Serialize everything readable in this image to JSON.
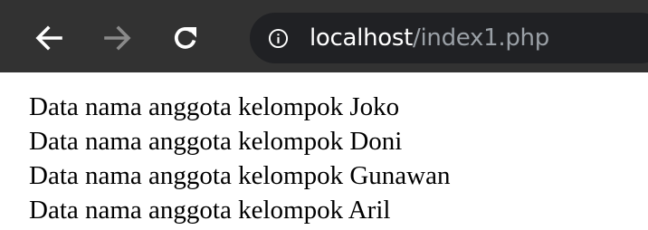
{
  "toolbar": {
    "back_icon": "arrow-left-icon",
    "forward_icon": "arrow-right-icon",
    "reload_icon": "reload-icon",
    "info_icon": "info-icon",
    "colors": {
      "toolbar_bg": "#323232",
      "omnibox_bg": "#202124",
      "icon_active": "#ffffff",
      "icon_disabled": "#8a8a8a",
      "url_path": "#9aa0a6"
    }
  },
  "address_bar": {
    "host": "localhost",
    "path": "/index1.php"
  },
  "page": {
    "lines": [
      "Data nama anggota kelompok Joko",
      "Data nama anggota kelompok Doni",
      "Data nama anggota kelompok Gunawan",
      "Data nama anggota kelompok Aril"
    ]
  }
}
